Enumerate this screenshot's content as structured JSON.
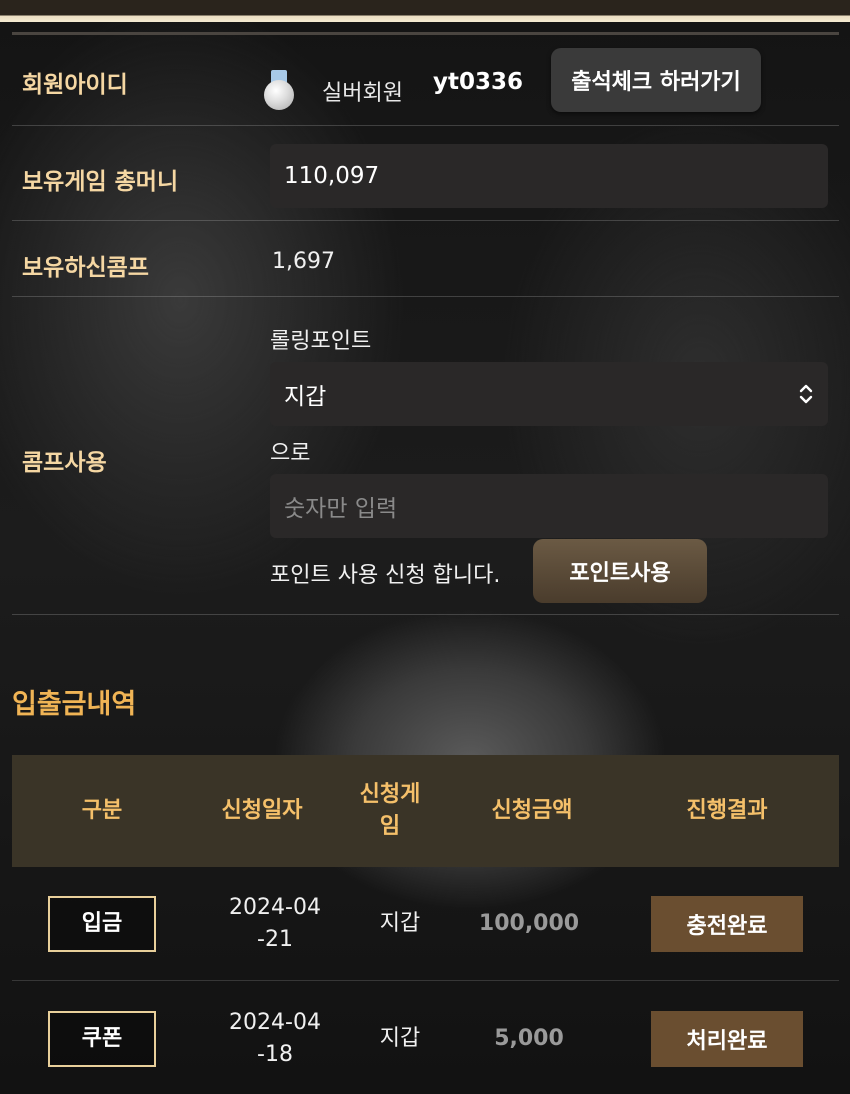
{
  "member": {
    "id_label": "회원아이디",
    "grade": "실버회원",
    "user_id": "yt0336",
    "attendance_button": "출석체크 하러가기"
  },
  "money": {
    "label": "보유게임 총머니",
    "value": "110,097"
  },
  "comp": {
    "label": "보유하신콤프",
    "value": "1,697"
  },
  "comp_use": {
    "label": "콤프사용",
    "rolling_label": "롤링포인트",
    "select_value": "지갑",
    "to_text": "으로",
    "amount_placeholder": "숫자만 입력",
    "request_text": "포인트 사용 신청 합니다.",
    "point_button": "포인트사용"
  },
  "history": {
    "title": "입출금내역",
    "headers": [
      "구분",
      "신청일자",
      "신청게임",
      "신청금액",
      "진행결과"
    ],
    "rows": [
      {
        "type": "입금",
        "date": "2024-04-21",
        "game": "지갑",
        "amount": "100,000",
        "status": "충전완료"
      },
      {
        "type": "쿠폰",
        "date": "2024-04-18",
        "game": "지갑",
        "amount": "5,000",
        "status": "처리완료"
      }
    ]
  },
  "colors": {
    "label_gold": "#f5d7a3",
    "section_orange": "#f0b455",
    "header_bg": "#3a3427",
    "status_bg": "#6a4e30"
  }
}
